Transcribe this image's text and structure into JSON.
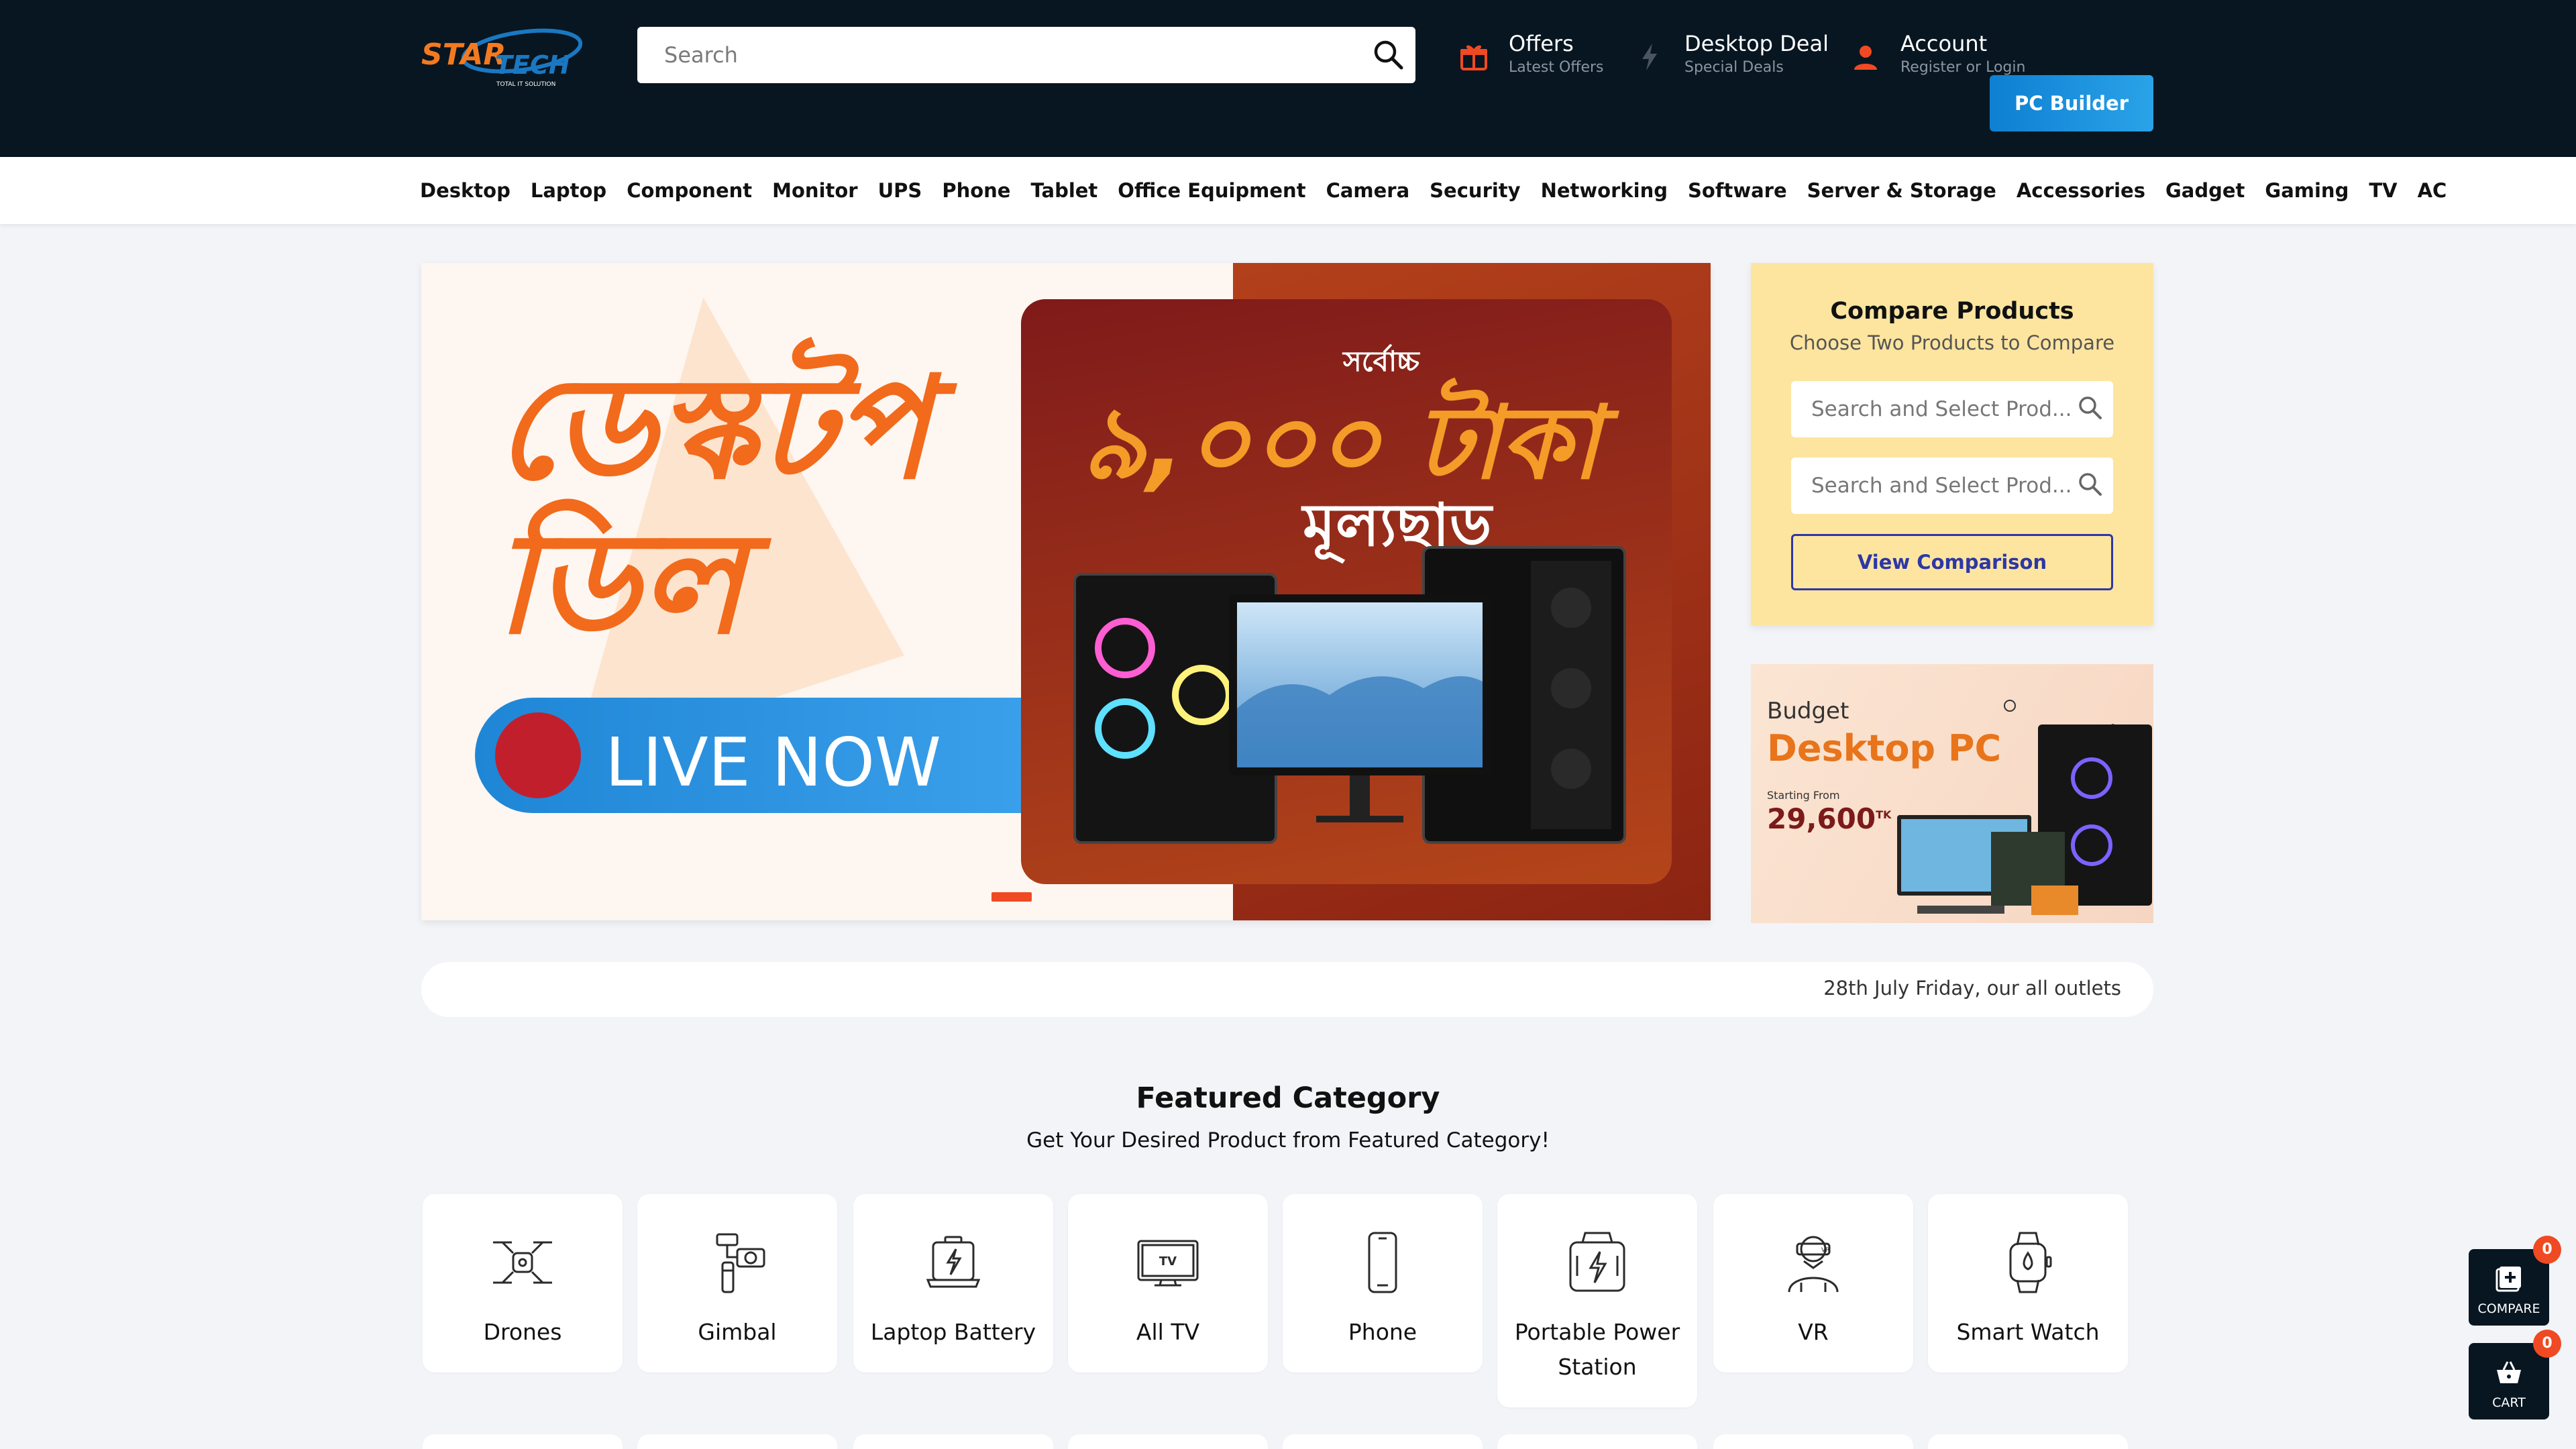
{
  "header": {
    "logo_text": "STAR TECH",
    "logo_tagline": "TOTAL IT SOLUTION",
    "search_placeholder": "Search",
    "offers": {
      "title": "Offers",
      "subtitle": "Latest Offers"
    },
    "desktop_deal": {
      "title": "Desktop Deal",
      "subtitle": "Special Deals"
    },
    "account": {
      "title": "Account",
      "subtitle": "Register or Login"
    },
    "pc_builder_label": "PC Builder",
    "accent_color": "#ef4a23"
  },
  "nav": {
    "items": [
      "Desktop",
      "Laptop",
      "Component",
      "Monitor",
      "UPS",
      "Phone",
      "Tablet",
      "Office Equipment",
      "Camera",
      "Security",
      "Networking",
      "Software",
      "Server & Storage",
      "Accessories",
      "Gadget",
      "Gaming",
      "TV",
      "AC"
    ]
  },
  "hero": {
    "title_bn": "ডেস্কটপ ডিল",
    "live_label": "LIVE NOW",
    "upto_bn": "সর্বোচ্চ",
    "amount_bn": "৯,০০০ টাকা",
    "discount_bn": "মূল্যছাড়",
    "active_slide": 1
  },
  "compare": {
    "title": "Compare Products",
    "subtitle": "Choose Two Products to Compare",
    "input1_placeholder": "Search and Select Prod...",
    "input2_placeholder": "Search and Select Prod...",
    "button_label": "View Comparison"
  },
  "budget_banner": {
    "line1": "Budget",
    "line2": "Desktop PC",
    "starting": "Starting From",
    "price": "29,600",
    "currency": "TK"
  },
  "notice": "28th July Friday, our all outlets",
  "featured": {
    "title": "Featured Category",
    "subtitle": "Get Your Desired Product from Featured Category!",
    "categories": [
      {
        "label": "Drones",
        "icon": "drone-icon"
      },
      {
        "label": "Gimbal",
        "icon": "gimbal-icon"
      },
      {
        "label": "Laptop Battery",
        "icon": "laptop-battery-icon"
      },
      {
        "label": "All TV",
        "icon": "tv-icon"
      },
      {
        "label": "Phone",
        "icon": "phone-icon"
      },
      {
        "label": "Portable Power Station",
        "icon": "power-station-icon"
      },
      {
        "label": "VR",
        "icon": "vr-icon"
      },
      {
        "label": "Smart Watch",
        "icon": "smart-watch-icon"
      }
    ]
  },
  "floating": {
    "compare_label": "COMPARE",
    "compare_count": "0",
    "cart_label": "CART",
    "cart_count": "0"
  }
}
